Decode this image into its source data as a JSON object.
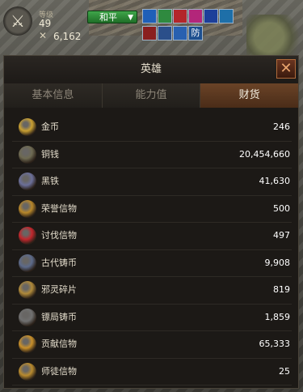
{
  "hud": {
    "level_label": "等级",
    "level": "49",
    "power": "6,162",
    "mode": "和平",
    "buffs": [
      {
        "icon": "blue-swirl-buff-icon",
        "color": "#1f5fb8"
      },
      {
        "icon": "green-leaf-buff-icon",
        "color": "#2f8a3f"
      },
      {
        "icon": "red-figure-buff-icon",
        "color": "#b3262a"
      },
      {
        "icon": "pink-potion-buff-icon",
        "color": "#b3267a"
      },
      {
        "icon": "blue-orb-buff-icon",
        "color": "#1d3f9a"
      },
      {
        "icon": "feather-buff-icon",
        "color": "#1e6fa8"
      },
      {
        "icon": "red-x-buff-icon",
        "color": "#8a1f1f"
      },
      {
        "icon": "shield-buff-icon",
        "color": "#2b4f8a"
      },
      {
        "icon": "wind-buff-icon",
        "color": "#2860b0"
      },
      {
        "icon": "defense-buff-icon",
        "color": "#1d4f8f",
        "label": "防"
      }
    ]
  },
  "panel": {
    "title": "英雄",
    "close": "✕",
    "tabs": [
      {
        "label": "基本信息",
        "active": false
      },
      {
        "label": "能力值",
        "active": false
      },
      {
        "label": "财货",
        "active": true
      }
    ],
    "currencies": [
      {
        "icon": "gold-coins-icon",
        "name": "金币",
        "amount": "246",
        "color": "#c9a032"
      },
      {
        "icon": "copper-coin-icon",
        "name": "铜钱",
        "amount": "20,454,660",
        "color": "#6e6a52"
      },
      {
        "icon": "black-iron-icon",
        "name": "黑铁",
        "amount": "41,630",
        "color": "#6b6f99"
      },
      {
        "icon": "honor-token-icon",
        "name": "荣誉信物",
        "amount": "500",
        "color": "#b8872a"
      },
      {
        "icon": "crusade-token-icon",
        "name": "讨伐信物",
        "amount": "497",
        "color": "#c2262c"
      },
      {
        "icon": "ancient-coin-icon",
        "name": "古代铸币",
        "amount": "9,908",
        "color": "#5c6a8a"
      },
      {
        "icon": "evil-spirit-shard-icon",
        "name": "邪灵碎片",
        "amount": "819",
        "color": "#b08a3a"
      },
      {
        "icon": "escort-coin-icon",
        "name": "镖局铸币",
        "amount": "1,859",
        "color": "#707070"
      },
      {
        "icon": "contribution-token-icon",
        "name": "贡献信物",
        "amount": "65,333",
        "color": "#c9902a"
      },
      {
        "icon": "disciple-token-icon",
        "name": "师徒信物",
        "amount": "25",
        "color": "#b98b2e"
      }
    ]
  }
}
